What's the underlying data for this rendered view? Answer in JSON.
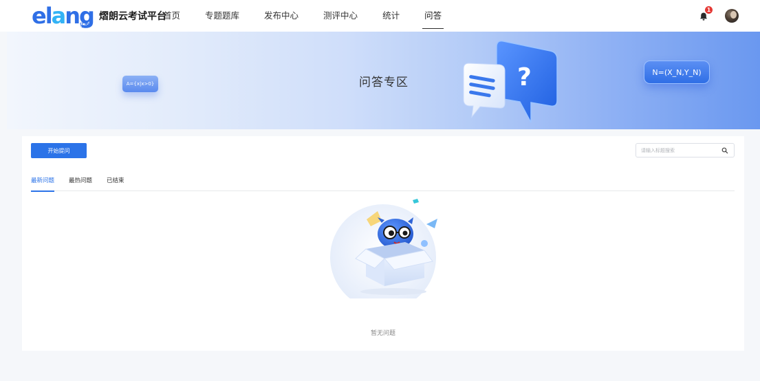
{
  "header": {
    "brand_sub": "亿朗",
    "brand_name": "熠朗云考试平台",
    "nav": [
      {
        "label": "首页"
      },
      {
        "label": "专题题库"
      },
      {
        "label": "发布中心"
      },
      {
        "label": "测评中心"
      },
      {
        "label": "统计"
      },
      {
        "label": "问答"
      }
    ],
    "active_nav": "问答",
    "notification_count": "1"
  },
  "banner": {
    "title": "问答专区",
    "formula_left": "A={x|x>0}",
    "formula_right": "N=(X_N,Y_N)",
    "question_mark": "?"
  },
  "toolbar": {
    "ask_label": "开始提问",
    "search_placeholder": "请输入标题搜索"
  },
  "tabs": [
    {
      "label": "最新问题"
    },
    {
      "label": "最热问题"
    },
    {
      "label": "已结束"
    }
  ],
  "active_tab": "最新问题",
  "empty_state": {
    "message": "暂无问题"
  },
  "colors": {
    "accent": "#2b73e8",
    "logo_blue": "#2f6fe6",
    "logo_cyan": "#33b3f5",
    "badge_red": "#e53935"
  },
  "icons": [
    "bell-icon",
    "search-icon",
    "avatar",
    "question-bubble-icon",
    "empty-box-mascot-illustration"
  ]
}
